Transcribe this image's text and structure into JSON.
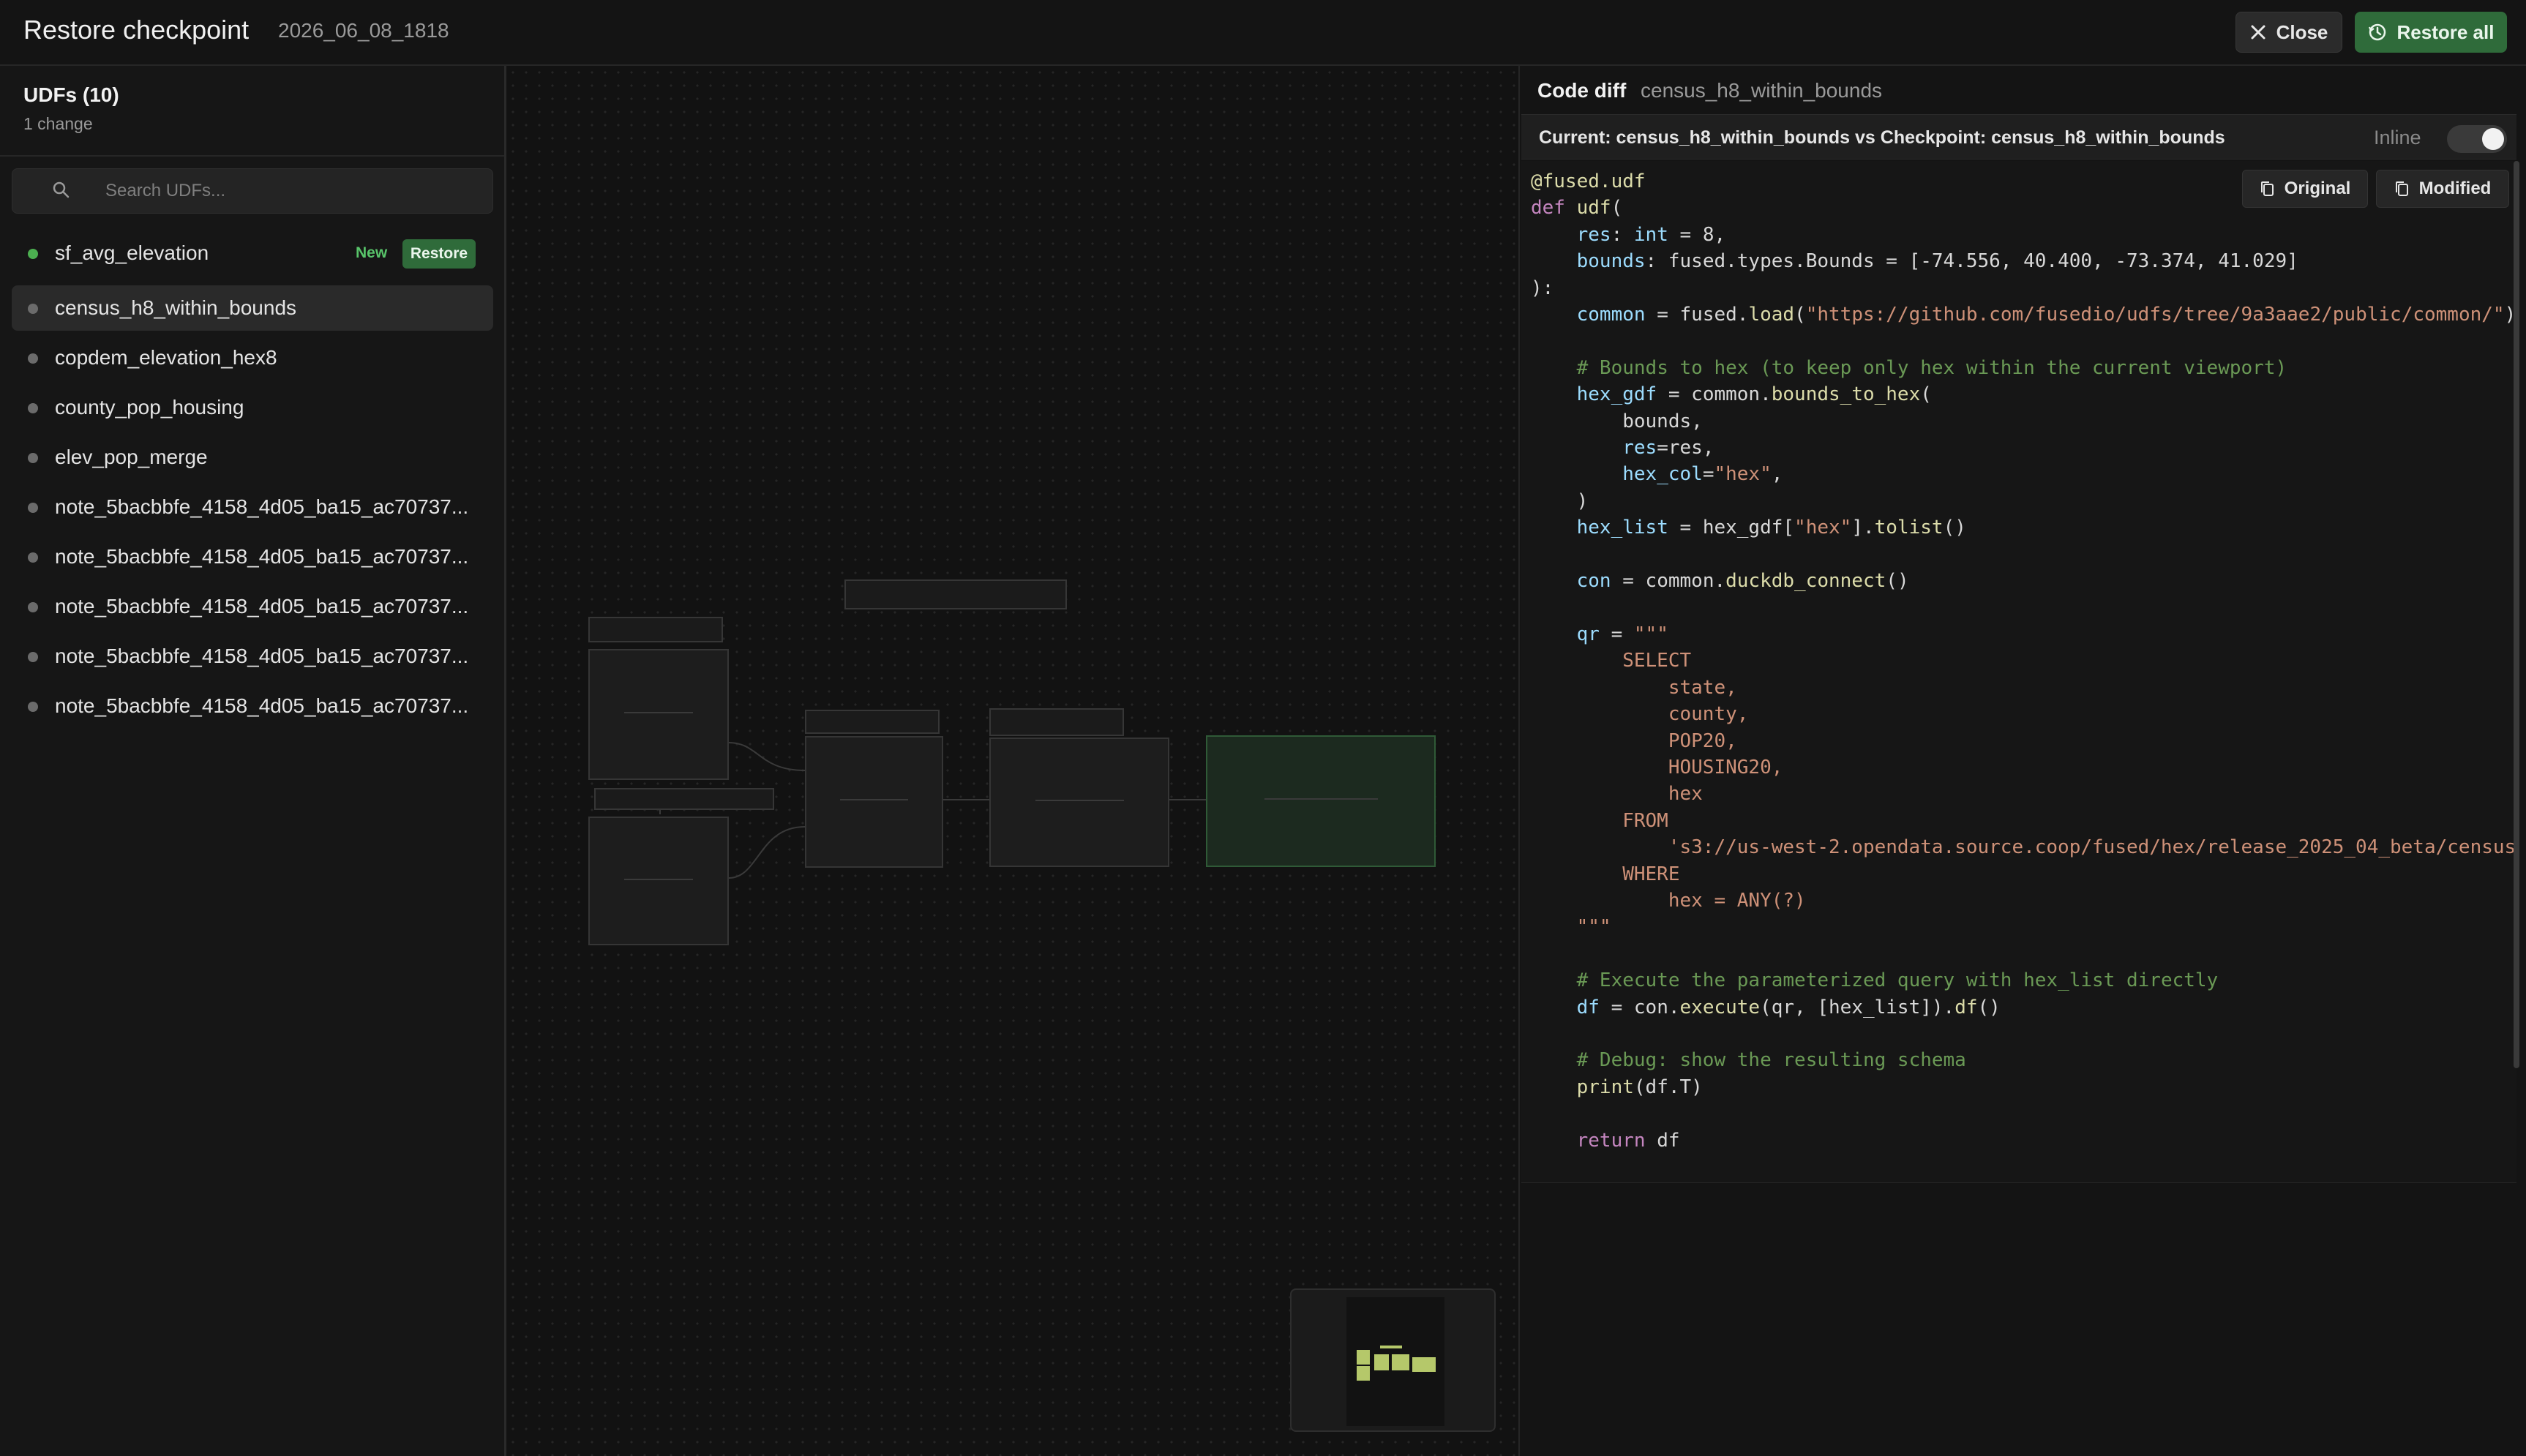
{
  "header": {
    "title": "Restore checkpoint",
    "checkpoint": "2026_06_08_1818",
    "close_label": "Close",
    "restore_all_label": "Restore all"
  },
  "sidebar": {
    "title": "UDFs (10)",
    "subtitle": "1 change",
    "search_placeholder": "Search UDFs...",
    "new_badge": "New",
    "restore_badge": "Restore",
    "items": [
      {
        "label": "sf_avg_elevation"
      },
      {
        "label": "census_h8_within_bounds"
      },
      {
        "label": "copdem_elevation_hex8"
      },
      {
        "label": "county_pop_housing"
      },
      {
        "label": "elev_pop_merge"
      },
      {
        "label": "note_5bacbbfe_4158_4d05_ba15_ac70737..."
      },
      {
        "label": "note_5bacbbfe_4158_4d05_ba15_ac70737..."
      },
      {
        "label": "note_5bacbbfe_4158_4d05_ba15_ac70737..."
      },
      {
        "label": "note_5bacbbfe_4158_4d05_ba15_ac70737..."
      },
      {
        "label": "note_5bacbbfe_4158_4d05_ba15_ac70737..."
      }
    ]
  },
  "diff": {
    "title": "Code diff",
    "udf_name": "census_h8_within_bounds",
    "compare": "Current: census_h8_within_bounds vs Checkpoint: census_h8_within_bounds",
    "inline_label": "Inline",
    "original_label": "Original",
    "modified_label": "Modified"
  },
  "colors": {
    "accent_green": "#2f6b3a",
    "new_badge": "#58c46a",
    "minimap_node": "#b5c86a"
  }
}
